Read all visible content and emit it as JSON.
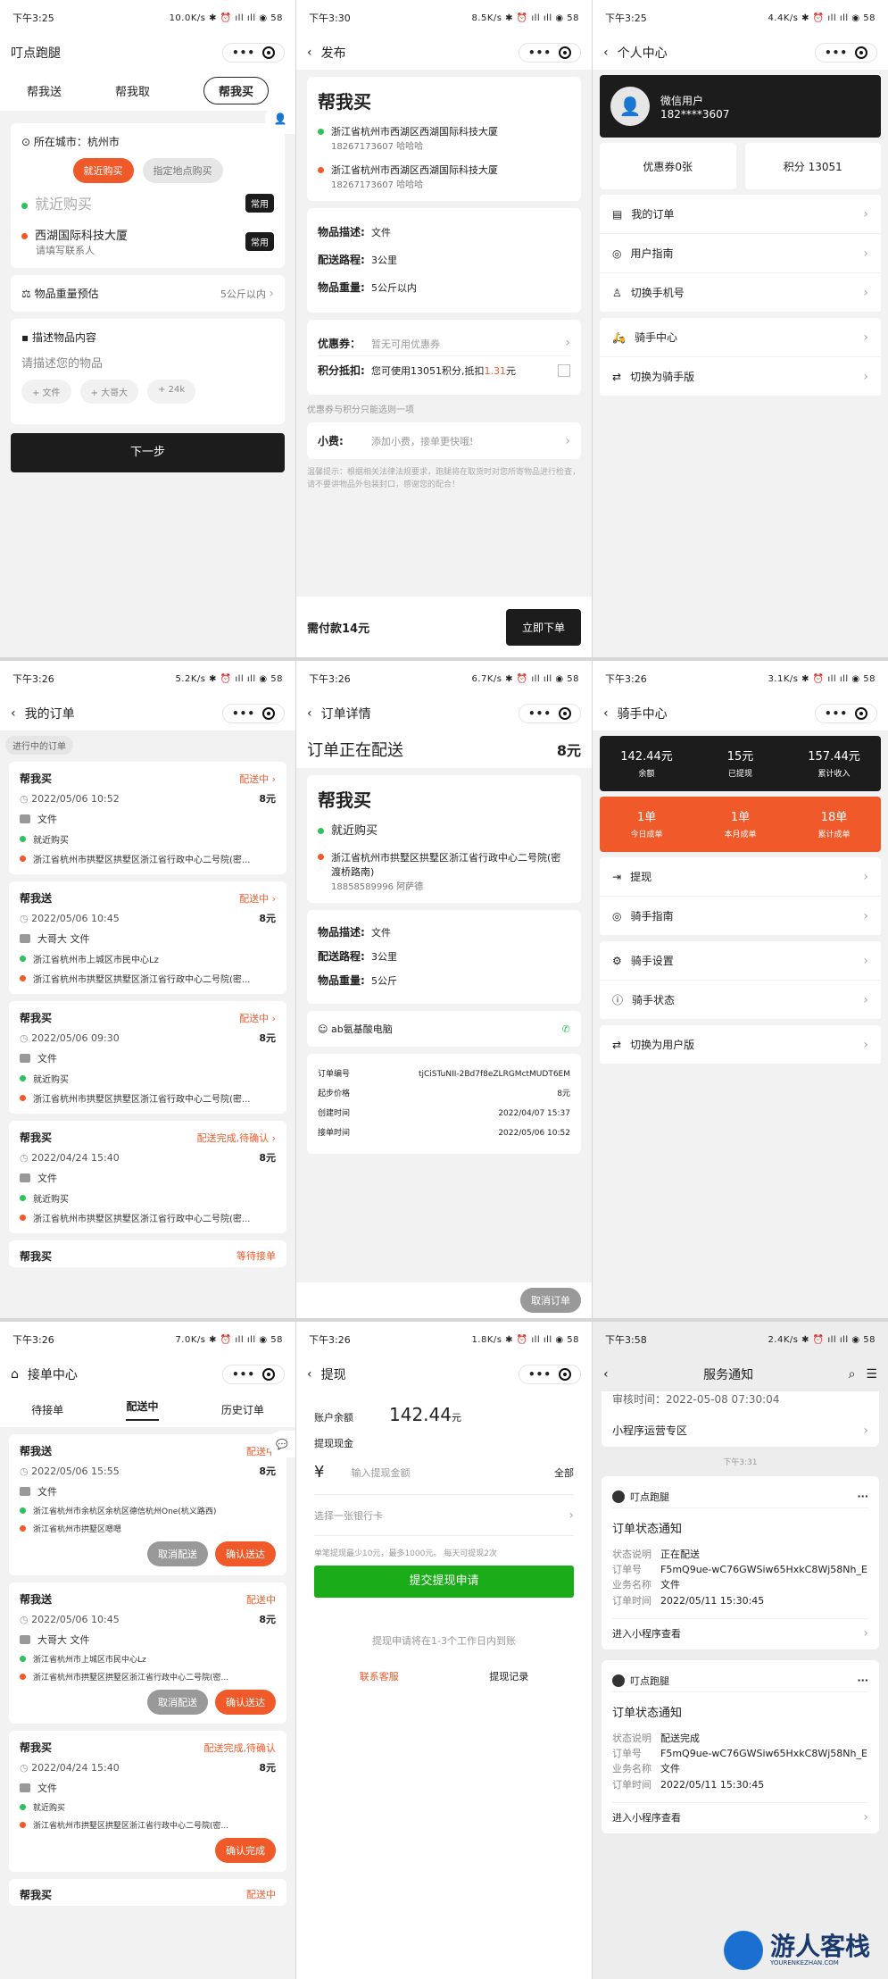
{
  "status": {
    "p1": {
      "time": "下午3:25",
      "icons": "10.0K/s ✱ ⏰ ıll ıll ◉ 58"
    },
    "p2": {
      "time": "下午3:30",
      "icons": "8.5K/s ✱ ⏰ ıll ıll ◉ 58"
    },
    "p3": {
      "time": "下午3:25",
      "icons": "4.4K/s ✱ ⏰ ıll ıll ◉ 58"
    },
    "p4": {
      "time": "下午3:26",
      "icons": "5.2K/s ✱ ⏰ ıll ıll ◉ 58"
    },
    "p5": {
      "time": "下午3:26",
      "icons": "6.7K/s ✱ ⏰ ıll ıll ◉ 58"
    },
    "p6": {
      "time": "下午3:26",
      "icons": "3.1K/s ✱ ⏰ ıll ıll ◉ 58"
    },
    "p7": {
      "time": "下午3:26",
      "icons": "7.0K/s ✱ ⏰ ıll ıll ◉ 58"
    },
    "p8": {
      "time": "下午3:26",
      "icons": "1.8K/s ✱ ⏰ ıll ıll ◉ 58"
    },
    "p9": {
      "time": "下午3:58",
      "icons": "2.4K/s ✱ ⏰ ıll ıll ◉ 58"
    }
  },
  "p1": {
    "title": "叮点跑腿",
    "tabs": [
      "帮我送",
      "帮我取",
      "帮我买"
    ],
    "city_label": "所在城市：杭州市",
    "btn_near": "就近购买",
    "btn_addr": "指定地点购买",
    "buy_placeholder": "就近购买",
    "common": "常用",
    "addr_name": "西湖国际科技大厦",
    "addr_sub": "请填写联系人",
    "weight_label": "物品重量预估",
    "weight_value": "5公斤以内",
    "desc_label": "描述物品内容",
    "desc_placeholder": "请描述您的物品",
    "tags": [
      "+ 文件",
      "+ 大哥大",
      "+ 24k"
    ],
    "next": "下一步"
  },
  "p2": {
    "title": "发布",
    "heading": "帮我买",
    "addr1": "浙江省杭州市西湖区西湖国际科技大厦",
    "addr1_sub": "18267173607 哈哈哈",
    "addr2": "浙江省杭州市西湖区西湖国际科技大厦",
    "addr2_sub": "18267173607 哈哈哈",
    "desc_label": "物品描述:",
    "desc_value": "文件",
    "route_label": "配送路程:",
    "route_value": "3公里",
    "weight_label": "物品重量:",
    "weight_value": "5公斤以内",
    "coupon_label": "优惠券：",
    "coupon_value": "暂无可用优惠券",
    "points_label": "积分抵扣:",
    "points_pre": "您可使用13051积分,抵扣",
    "points_amt": "1.31",
    "points_unit": "元",
    "note": "优惠券与积分只能选则一项",
    "tip_label": "小费:",
    "tip_value": "添加小费，接单更快哦!",
    "warm": "温馨提示：根据相关法律法规要求，跑腿将在取货时对您所寄物品进行检查，请不要讲物品外包装封口，感谢您的配合！",
    "total": "需付款14元",
    "order_btn": "立即下单"
  },
  "p3": {
    "title": "个人中心",
    "user": "微信用户",
    "phone": "182****3607",
    "coupon": "优惠券0张",
    "points": "积分 13051",
    "menu1": [
      "我的订单",
      "用户指南",
      "切换手机号"
    ],
    "menu2": [
      "骑手中心",
      "切换为骑手版"
    ]
  },
  "p4": {
    "title": "我的订单",
    "filter": "进行中的订单",
    "orders": [
      {
        "type": "帮我买",
        "status": "配送中",
        "date": "2022/05/06 10:52",
        "price": "8元",
        "item": "文件",
        "from": "就近购买",
        "to": "浙江省杭州市拱墅区拱墅区浙江省行政中心二号院(密..."
      },
      {
        "type": "帮我送",
        "status": "配送中",
        "date": "2022/05/06 10:45",
        "price": "8元",
        "item": "大哥大 文件",
        "from": "浙江省杭州市上城区市民中心Lz",
        "to": "浙江省杭州市拱墅区拱墅区浙江省行政中心二号院(密..."
      },
      {
        "type": "帮我买",
        "status": "配送中",
        "date": "2022/05/06 09:30",
        "price": "8元",
        "item": "文件",
        "from": "就近购买",
        "to": "浙江省杭州市拱墅区拱墅区浙江省行政中心二号院(密..."
      },
      {
        "type": "帮我买",
        "status": "配送完成,待确认",
        "date": "2022/04/24 15:40",
        "price": "8元",
        "item": "文件",
        "from": "就近购买",
        "to": "浙江省杭州市拱墅区拱墅区浙江省行政中心二号院(密..."
      }
    ],
    "last_type": "帮我买",
    "last_status": "等待接单"
  },
  "p5": {
    "title": "订单详情",
    "state": "订单正在配送",
    "price": "8元",
    "heading": "帮我买",
    "from": "就近购买",
    "to": "浙江省杭州市拱墅区拱墅区浙江省行政中心二号院(密渡桥路南)",
    "to_sub": "18858589996 阿萨德",
    "desc_label": "物品描述:",
    "desc_value": "文件",
    "route_label": "配送路程:",
    "route_value": "3公里",
    "weight_label": "物品重量:",
    "weight_value": "5公斤",
    "rider": "ab氨基酸电脑",
    "no_label": "订单编号",
    "no_value": "tjCiSTuNII-2Bd7f8eZLRGMctMUDT6EM",
    "base_label": "起步价格",
    "base_value": "8元",
    "ctime_label": "创建时间",
    "ctime_value": "2022/04/07 15:37",
    "atime_label": "接单时间",
    "atime_value": "2022/05/06 10:52",
    "cancel": "取消订单"
  },
  "p6": {
    "title": "骑手中心",
    "stats": [
      {
        "v": "142.44元",
        "l": "余额"
      },
      {
        "v": "15元",
        "l": "已提现"
      },
      {
        "v": "157.44元",
        "l": "累计收入"
      }
    ],
    "counts": [
      {
        "v": "1单",
        "l": "今日成单"
      },
      {
        "v": "1单",
        "l": "本月成单"
      },
      {
        "v": "18单",
        "l": "累计成单"
      }
    ],
    "menu1": [
      "提现",
      "骑手指南"
    ],
    "menu2": [
      "骑手设置",
      "骑手状态"
    ],
    "menu3": [
      "切换为用户版"
    ]
  },
  "p7": {
    "title": "接单中心",
    "tabs": [
      "待接单",
      "配送中",
      "历史订单"
    ],
    "orders": [
      {
        "type": "帮我送",
        "status": "配送中",
        "date": "2022/05/06 15:55",
        "price": "8元",
        "item": "文件",
        "from": "浙江省杭州市余杭区余杭区德信杭州One(杭义路西)",
        "to": "浙江省杭州市拱墅区嗯嗯",
        "b1": "取消配送",
        "b2": "确认送达"
      },
      {
        "type": "帮我送",
        "status": "配送中",
        "date": "2022/05/06 10:45",
        "price": "8元",
        "item": "大哥大 文件",
        "from": "浙江省杭州市上城区市民中心Lz",
        "to": "浙江省杭州市拱墅区拱墅区浙江省行政中心二号院(密...",
        "b1": "取消配送",
        "b2": "确认送达"
      },
      {
        "type": "帮我买",
        "status": "配送完成,待确认",
        "date": "2022/04/24 15:40",
        "price": "8元",
        "item": "文件",
        "from": "就近购买",
        "to": "浙江省杭州市拱墅区拱墅区浙江省行政中心二号院(密...",
        "b2": "确认完成"
      }
    ],
    "last_type": "帮我买",
    "last_status": "配送中"
  },
  "p8": {
    "title": "提现",
    "balance_label": "账户余额",
    "balance": "142.44",
    "balance_unit": "元",
    "cash_label": "提现现金",
    "currency": "¥",
    "amount_placeholder": "输入提现金额",
    "all": "全部",
    "bank": "选择一张银行卡",
    "rule": "单笔提现最少10元，最多1000元。 每天可提现2次",
    "submit": "提交提现申请",
    "note": "提现申请将在1-3个工作日内到账",
    "service": "联系客服",
    "records": "提现记录"
  },
  "p9": {
    "title": "服务通知",
    "top_text": "审核时间：2022-05-08 07:30:04",
    "mini_zone": "小程序运营专区",
    "time_sep": "下午3:31",
    "cards": [
      {
        "app": "叮点跑腿",
        "title": "订单状态通知",
        "s_label": "状态说明",
        "s_value": "正在配送",
        "no_label": "订单号",
        "no_value": "F5mQ9ue-wC76GWSiw65HxkC8Wj58Nh_E",
        "biz_label": "业务名称",
        "biz_value": "文件",
        "time_label": "订单时间",
        "time_value": "2022/05/11 15:30:45",
        "enter": "进入小程序查看"
      },
      {
        "app": "叮点跑腿",
        "title": "订单状态通知",
        "s_label": "状态说明",
        "s_value": "配送完成",
        "no_label": "订单号",
        "no_value": "F5mQ9ue-wC76GWSiw65HxkC8Wj58Nh_E",
        "biz_label": "业务名称",
        "biz_value": "文件",
        "time_label": "订单时间",
        "time_value": "2022/05/11 15:30:45",
        "enter": "进入小程序查看"
      }
    ],
    "watermark": "游人客栈",
    "watermark_sub": "YOURENKEZHAN.COM"
  },
  "colors": {
    "accent": "#f05a2a",
    "dark": "#1c1c1c",
    "green": "#1aad19"
  }
}
